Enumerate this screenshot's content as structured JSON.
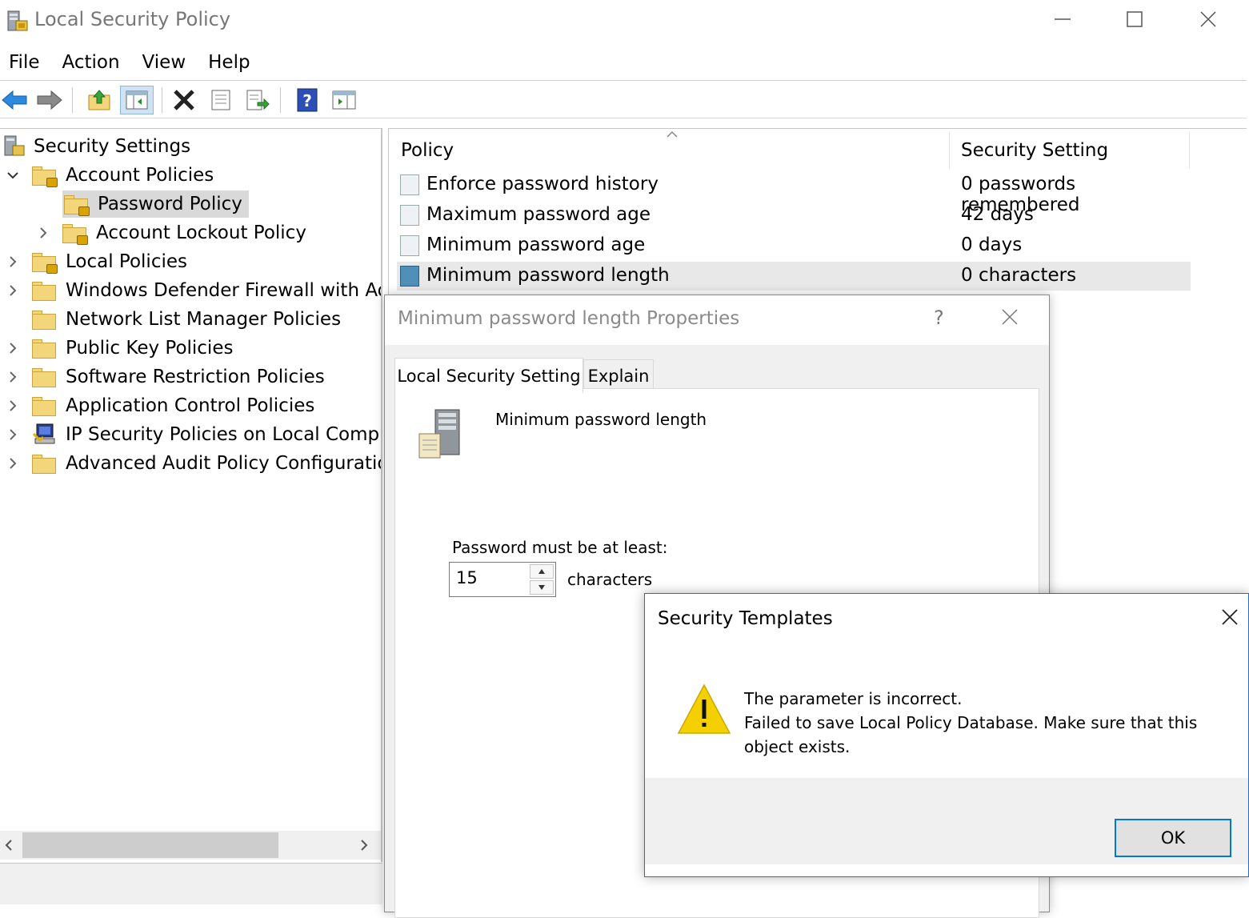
{
  "window": {
    "title": "Local Security Policy"
  },
  "menu": [
    "File",
    "Action",
    "View",
    "Help"
  ],
  "toolbar": {
    "icons": [
      "back-arrow-icon",
      "forward-arrow-icon",
      "up-folder-icon",
      "show-hide-tree-icon",
      "delete-icon",
      "properties-icon",
      "export-list-icon",
      "help-icon",
      "show-action-pane-icon"
    ]
  },
  "tree": {
    "root": "Security Settings",
    "items": [
      {
        "label": "Account Policies"
      },
      {
        "label": "Password Policy"
      },
      {
        "label": "Account Lockout Policy"
      },
      {
        "label": "Local Policies"
      },
      {
        "label": "Windows Defender Firewall with Advanced Security"
      },
      {
        "label": "Network List Manager Policies"
      },
      {
        "label": "Public Key Policies"
      },
      {
        "label": "Software Restriction Policies"
      },
      {
        "label": "Application Control Policies"
      },
      {
        "label": "IP Security Policies on Local Computer"
      },
      {
        "label": "Advanced Audit Policy Configuration"
      }
    ]
  },
  "list": {
    "columns": [
      "Policy",
      "Security Setting"
    ],
    "rows": [
      {
        "policy": "Enforce password history",
        "setting": "0 passwords remembered"
      },
      {
        "policy": "Maximum password age",
        "setting": "42 days"
      },
      {
        "policy": "Minimum password age",
        "setting": "0 days"
      },
      {
        "policy": "Minimum password length",
        "setting": "0 characters"
      }
    ]
  },
  "properties_dialog": {
    "title": "Minimum password length Properties",
    "help": "?",
    "tabs": [
      "Local Security Setting",
      "Explain"
    ],
    "policy_name": "Minimum password length",
    "field_label": "Password must be at least:",
    "value": "15",
    "units": "characters"
  },
  "error_dialog": {
    "title": "Security Templates",
    "message_line1": "The parameter is incorrect.",
    "message_line2": "Failed to save Local Policy Database. Make sure that this object exists.",
    "ok_label": "OK"
  },
  "colors": {
    "accent": "#0078d7",
    "warning": "#f5d000"
  }
}
